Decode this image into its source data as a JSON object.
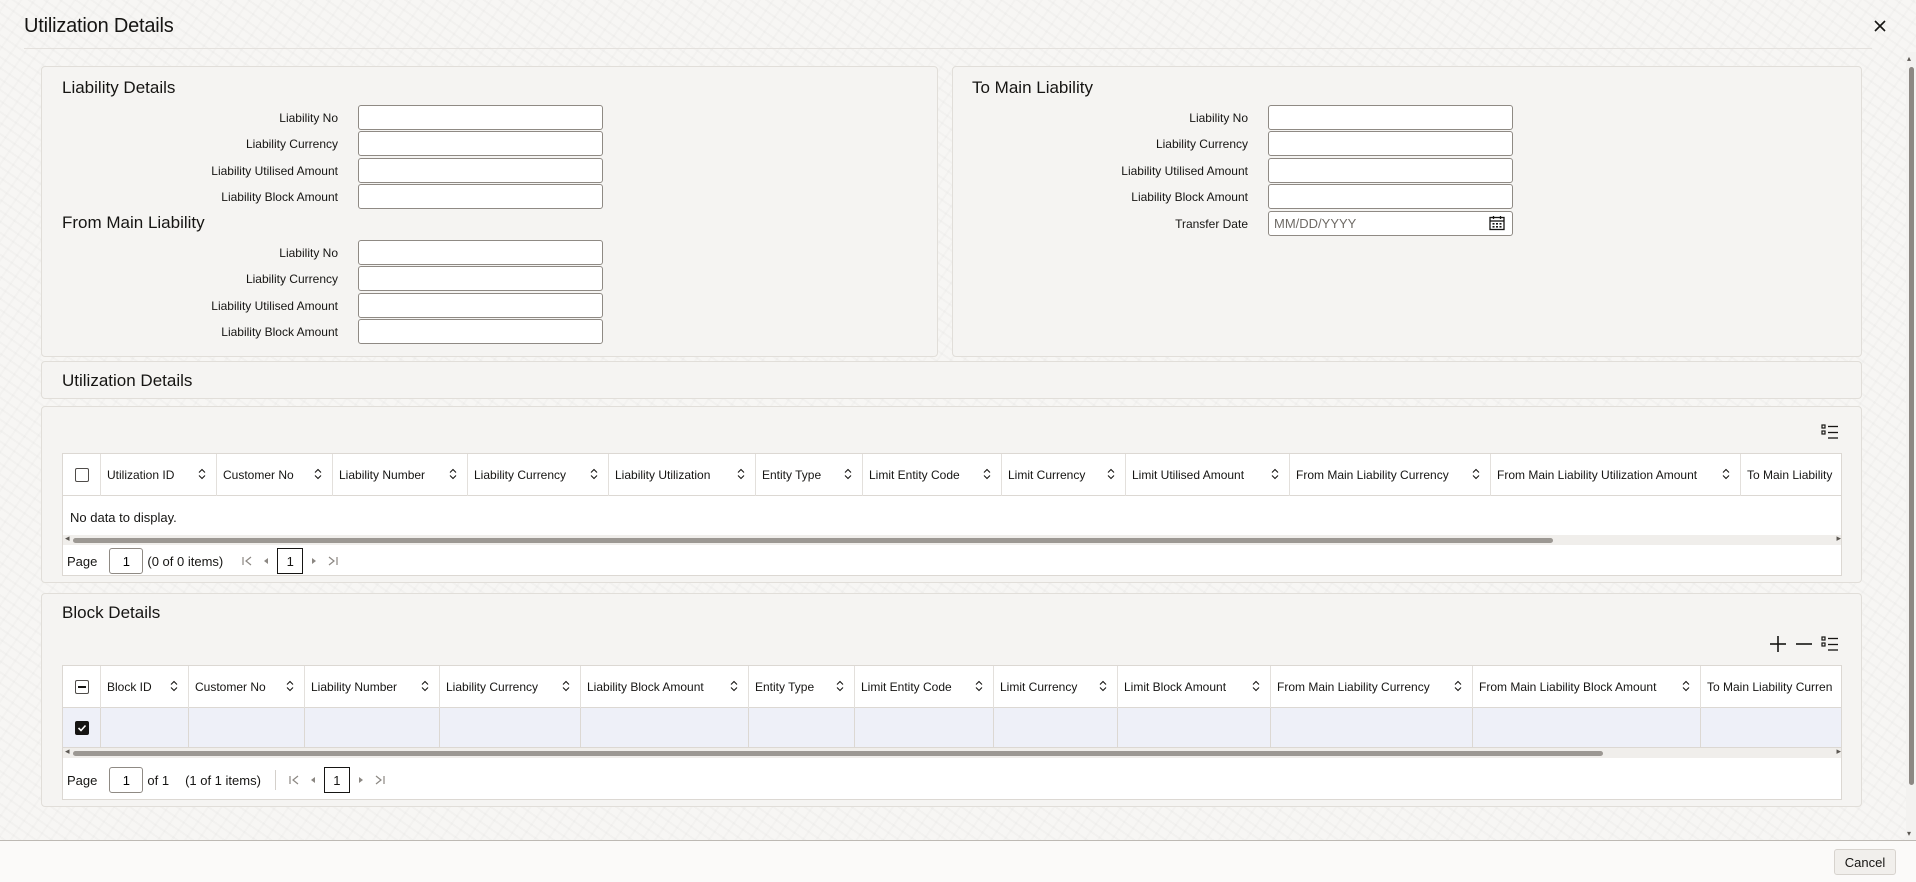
{
  "dialog": {
    "title": "Utilization Details",
    "close_symbol": "✕"
  },
  "liability_details": {
    "title": "Liability Details",
    "fields": [
      {
        "label": "Liability No",
        "value": ""
      },
      {
        "label": "Liability Currency",
        "value": ""
      },
      {
        "label": "Liability Utilised Amount",
        "value": ""
      },
      {
        "label": "Liability Block Amount",
        "value": ""
      }
    ]
  },
  "from_main_liability": {
    "title": "From Main Liability",
    "fields": [
      {
        "label": "Liability No",
        "value": ""
      },
      {
        "label": "Liability Currency",
        "value": ""
      },
      {
        "label": "Liability Utilised Amount",
        "value": ""
      },
      {
        "label": "Liability Block Amount",
        "value": ""
      }
    ]
  },
  "to_main_liability": {
    "title": "To Main Liability",
    "fields": [
      {
        "label": "Liability No",
        "value": ""
      },
      {
        "label": "Liability Currency",
        "value": ""
      },
      {
        "label": "Liability Utilised Amount",
        "value": ""
      },
      {
        "label": "Liability Block Amount",
        "value": ""
      }
    ],
    "transfer_date": {
      "label": "Transfer Date",
      "value": "",
      "placeholder": "MM/DD/YYYY"
    }
  },
  "utilization_grid": {
    "title": "Utilization Details",
    "columns": [
      "Utilization ID",
      "Customer No",
      "Liability Number",
      "Liability Currency",
      "Liability Utilization",
      "Entity Type",
      "Limit Entity Code",
      "Limit Currency",
      "Limit Utilised Amount",
      "From Main Liability Currency",
      "From Main Liability Utilization Amount",
      "To Main Liability"
    ],
    "empty_text": "No data to display.",
    "pager": {
      "page_label": "Page",
      "page_value": "1",
      "summary": "(0 of 0 items)",
      "current_page": "1"
    }
  },
  "block_grid": {
    "title": "Block Details",
    "columns": [
      "Block ID",
      "Customer No",
      "Liability Number",
      "Liability Currency",
      "Liability Block Amount",
      "Entity Type",
      "Limit Entity Code",
      "Limit Currency",
      "Limit Block Amount",
      "From Main Liability Currency",
      "From Main Liability Block Amount",
      "To Main Liability Curren"
    ],
    "pager": {
      "page_label": "Page",
      "page_value": "1",
      "of_text": "of 1",
      "summary": "(1 of 1 items)",
      "current_page": "1"
    }
  },
  "footer": {
    "cancel_label": "Cancel"
  }
}
